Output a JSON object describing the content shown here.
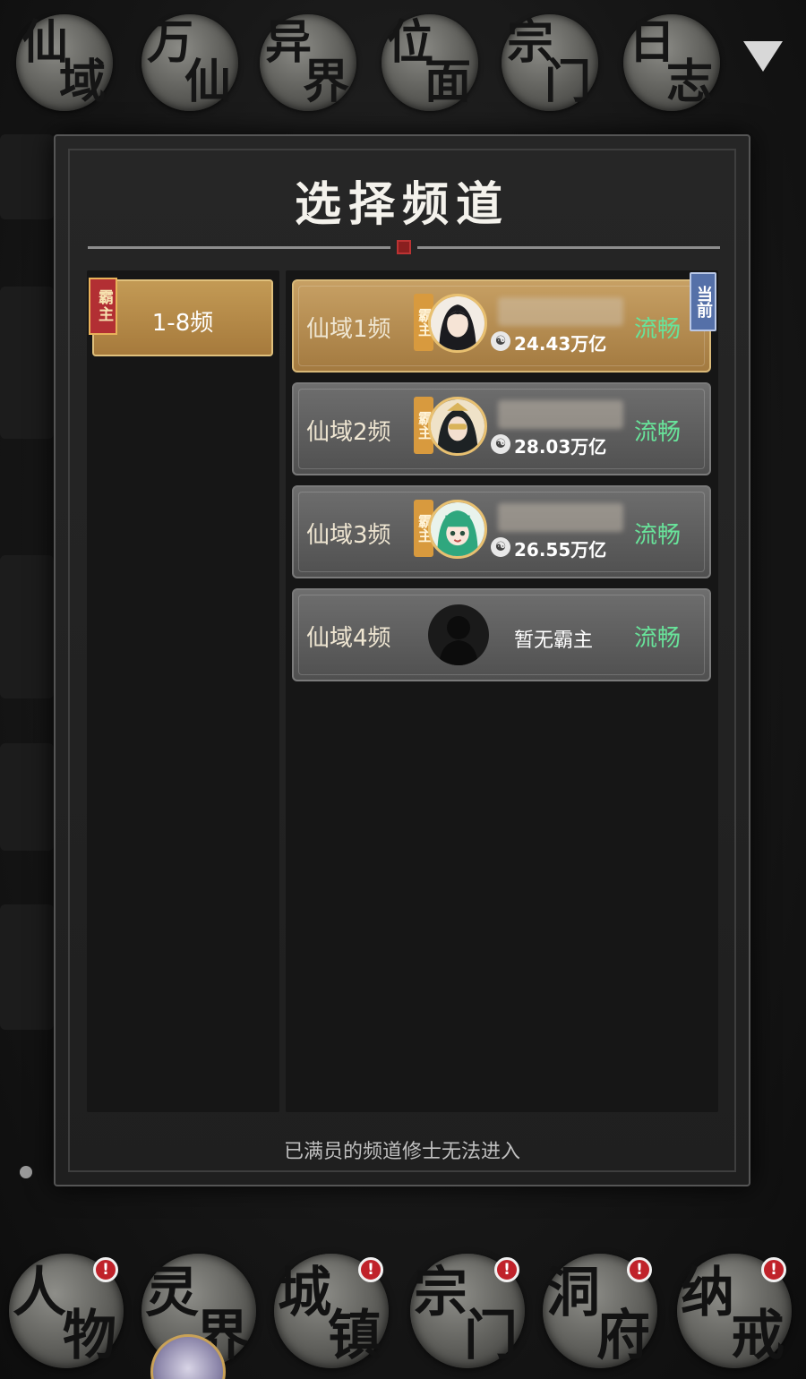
{
  "top_nav": {
    "items": [
      {
        "c1": "仙",
        "c2": "域"
      },
      {
        "c1": "万",
        "c2": "仙"
      },
      {
        "c1": "异",
        "c2": "界"
      },
      {
        "c1": "位",
        "c2": "面"
      },
      {
        "c1": "宗",
        "c2": "门"
      },
      {
        "c1": "日",
        "c2": "志"
      }
    ]
  },
  "modal": {
    "title": "选择频道",
    "group": {
      "tag": "霸主",
      "label": "1-8频"
    },
    "channels": [
      {
        "name": "仙域1频",
        "tag": "霸主",
        "power": "24.43万亿",
        "status": "流畅",
        "current_tag": "当前"
      },
      {
        "name": "仙域2频",
        "tag": "霸主",
        "power": "28.03万亿",
        "status": "流畅"
      },
      {
        "name": "仙域3频",
        "tag": "霸主",
        "power": "26.55万亿",
        "status": "流畅"
      },
      {
        "name": "仙域4频",
        "no_owner": "暂无霸主",
        "status": "流畅"
      }
    ],
    "footer": "已满员的频道修士无法进入"
  },
  "bottom_nav": {
    "items": [
      {
        "c1": "人",
        "c2": "物",
        "alert": "!"
      },
      {
        "c1": "灵",
        "c2": "界",
        "alert": ""
      },
      {
        "c1": "城",
        "c2": "镇",
        "alert": "!"
      },
      {
        "c1": "宗",
        "c2": "门",
        "alert": "!"
      },
      {
        "c1": "洞",
        "c2": "府",
        "alert": "!"
      },
      {
        "c1": "纳",
        "c2": "戒",
        "alert": "!"
      }
    ]
  },
  "colors": {
    "status_green": "#68e39a",
    "active_gold": "#c7a064",
    "overlord_red": "#b22f33",
    "current_blue": "#5570a8"
  }
}
